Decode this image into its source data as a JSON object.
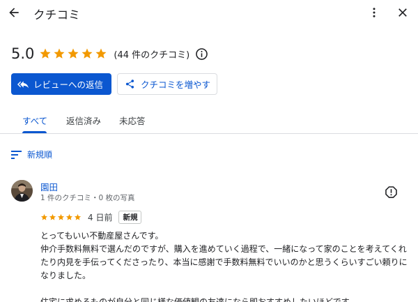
{
  "header": {
    "title": "クチコミ"
  },
  "summary": {
    "score": "5.0",
    "stars": 5,
    "count_text": "(44 件のクチコミ)"
  },
  "buttons": {
    "reply_label": "レビューへの返信",
    "share_label": "クチコミを増やす"
  },
  "tabs": [
    {
      "label": "すべて",
      "active": true
    },
    {
      "label": "返信済み",
      "active": false
    },
    {
      "label": "未応答",
      "active": false
    }
  ],
  "sort": {
    "label": "新規順"
  },
  "review": {
    "name": "園田",
    "meta": "1 件のクチコミ・0 枚の写真",
    "stars": 5,
    "date": "4 日前",
    "badge": "新規",
    "lines": [
      "とってもいい不動産屋さんです。",
      "仲介手数料無料で選んだのですが、購入を進めていく過程で、一緒になって家のことを考えてくれたり内見を手伝ってくださったり、本当に感謝で手数料無料でいいのかと思うくらいすごい頼りになりました。",
      "",
      "住宅に求めるものが自分と同じ様な価値観の友達になら即おすすめしたいほどです。"
    ]
  },
  "colors": {
    "accent": "#0b57d0",
    "star": "#f29900",
    "text": "#202124",
    "muted": "#5f6368"
  }
}
